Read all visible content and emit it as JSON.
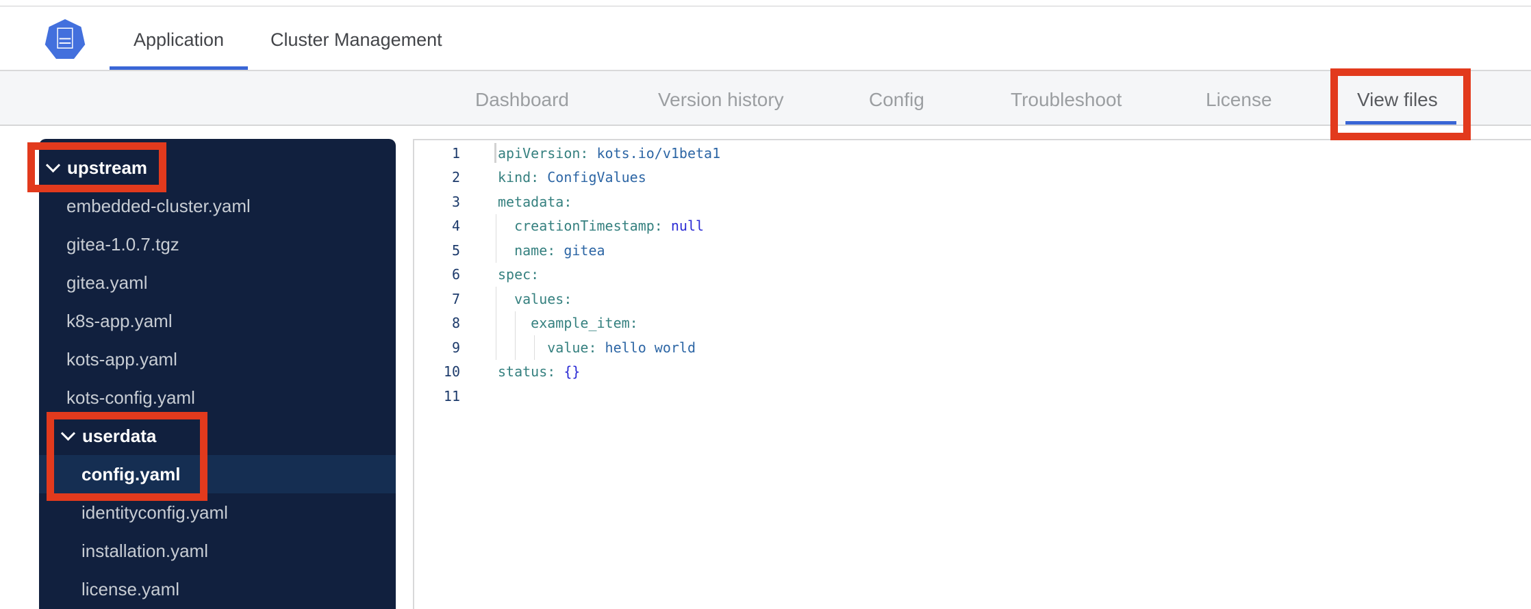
{
  "header": {
    "logo": "kubernetes-helm-icon",
    "tabs": [
      {
        "label": "Application",
        "active": true
      },
      {
        "label": "Cluster Management",
        "active": false
      }
    ]
  },
  "nav": {
    "tabs": [
      {
        "label": "Dashboard",
        "active": false
      },
      {
        "label": "Version history",
        "active": false
      },
      {
        "label": "Config",
        "active": false
      },
      {
        "label": "Troubleshoot",
        "active": false
      },
      {
        "label": "License",
        "active": false
      },
      {
        "label": "View files",
        "active": true,
        "annotated": true
      }
    ]
  },
  "file_tree": {
    "items": [
      {
        "type": "folder",
        "label": "upstream",
        "level": 0,
        "expanded": true,
        "annotated": true
      },
      {
        "type": "file",
        "label": "embedded-cluster.yaml",
        "level": 1
      },
      {
        "type": "file",
        "label": "gitea-1.0.7.tgz",
        "level": 1
      },
      {
        "type": "file",
        "label": "gitea.yaml",
        "level": 1
      },
      {
        "type": "file",
        "label": "k8s-app.yaml",
        "level": 1
      },
      {
        "type": "file",
        "label": "kots-app.yaml",
        "level": 1
      },
      {
        "type": "file",
        "label": "kots-config.yaml",
        "level": 1
      },
      {
        "type": "folder",
        "label": "userdata",
        "level": 1,
        "expanded": true,
        "annotated": true
      },
      {
        "type": "file",
        "label": "config.yaml",
        "level": 2,
        "selected": true,
        "annotated": true
      },
      {
        "type": "file",
        "label": "identityconfig.yaml",
        "level": 2
      },
      {
        "type": "file",
        "label": "installation.yaml",
        "level": 2
      },
      {
        "type": "file",
        "label": "license.yaml",
        "level": 2
      }
    ]
  },
  "editor": {
    "language": "yaml",
    "lines": [
      {
        "num": "1",
        "cursor": true,
        "guides": 0,
        "segments": [
          {
            "text": "apiVersion:",
            "style": "key"
          },
          {
            "text": " kots.io/v1beta1",
            "style": "value"
          }
        ]
      },
      {
        "num": "2",
        "guides": 0,
        "segments": [
          {
            "text": "kind:",
            "style": "key"
          },
          {
            "text": " ConfigValues",
            "style": "value"
          }
        ]
      },
      {
        "num": "3",
        "guides": 0,
        "segments": [
          {
            "text": "metadata:",
            "style": "key"
          }
        ]
      },
      {
        "num": "4",
        "guides": 1,
        "segments": [
          {
            "text": "  creationTimestamp:",
            "style": "key"
          },
          {
            "text": " null",
            "style": "const"
          }
        ]
      },
      {
        "num": "5",
        "guides": 1,
        "segments": [
          {
            "text": "  name:",
            "style": "key"
          },
          {
            "text": " gitea",
            "style": "value"
          }
        ]
      },
      {
        "num": "6",
        "guides": 0,
        "segments": [
          {
            "text": "spec:",
            "style": "key"
          }
        ]
      },
      {
        "num": "7",
        "guides": 1,
        "segments": [
          {
            "text": "  values:",
            "style": "key"
          }
        ]
      },
      {
        "num": "8",
        "guides": 2,
        "segments": [
          {
            "text": "    example_item:",
            "style": "key"
          }
        ]
      },
      {
        "num": "9",
        "guides": 3,
        "segments": [
          {
            "text": "      value:",
            "style": "key"
          },
          {
            "text": " hello world",
            "style": "value"
          }
        ]
      },
      {
        "num": "10",
        "guides": 0,
        "segments": [
          {
            "text": "status:",
            "style": "key"
          },
          {
            "text": " {}",
            "style": "const"
          }
        ]
      },
      {
        "num": "11",
        "guides": 0,
        "segments": []
      }
    ]
  },
  "colors": {
    "accent_blue": "#3a66d6",
    "annotation_red": "#e23a1d",
    "sidebar_bg": "#11203e",
    "sidebar_selected_bg": "#152e52",
    "code_key": "#35807f",
    "code_value": "#2d66a5",
    "code_constant": "#2a2ad4",
    "line_number": "#1c3a6b"
  }
}
